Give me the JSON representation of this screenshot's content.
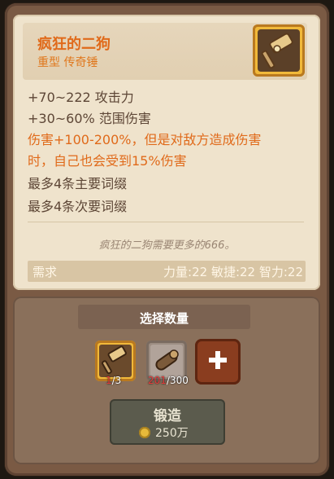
{
  "item": {
    "name": "疯狂的二狗",
    "subtitle": "重型 传奇锤",
    "icon": "legendary-hammer-icon"
  },
  "stats": [
    "+70~222 攻击力",
    "+30~60% 范围伤害",
    "伤害+100-200%，但是对敌方造成伤害",
    "时，自己也会受到15%伤害",
    "最多4条主要词缀",
    "最多4条次要词缀"
  ],
  "flavor": "疯狂的二狗需要更多的666。",
  "requirement": {
    "label": "需求",
    "values": "力量:22 敏捷:22 智力:22"
  },
  "forge_panel": {
    "select_label": "选择数量",
    "slot1": {
      "icon": "hammer-material-icon",
      "have": "1",
      "need": "/3"
    },
    "slot2": {
      "icon": "log-material-icon",
      "have": "201",
      "need": "/300"
    },
    "add_icon": "plus-icon",
    "forge_label": "锻造",
    "forge_cost": "250万",
    "coin_icon": "gold-coin-icon"
  },
  "colors": {
    "accent_orange": "#e06a1a",
    "gold_frame": "#f1b93a",
    "insufficient_red": "#e53b3b"
  }
}
